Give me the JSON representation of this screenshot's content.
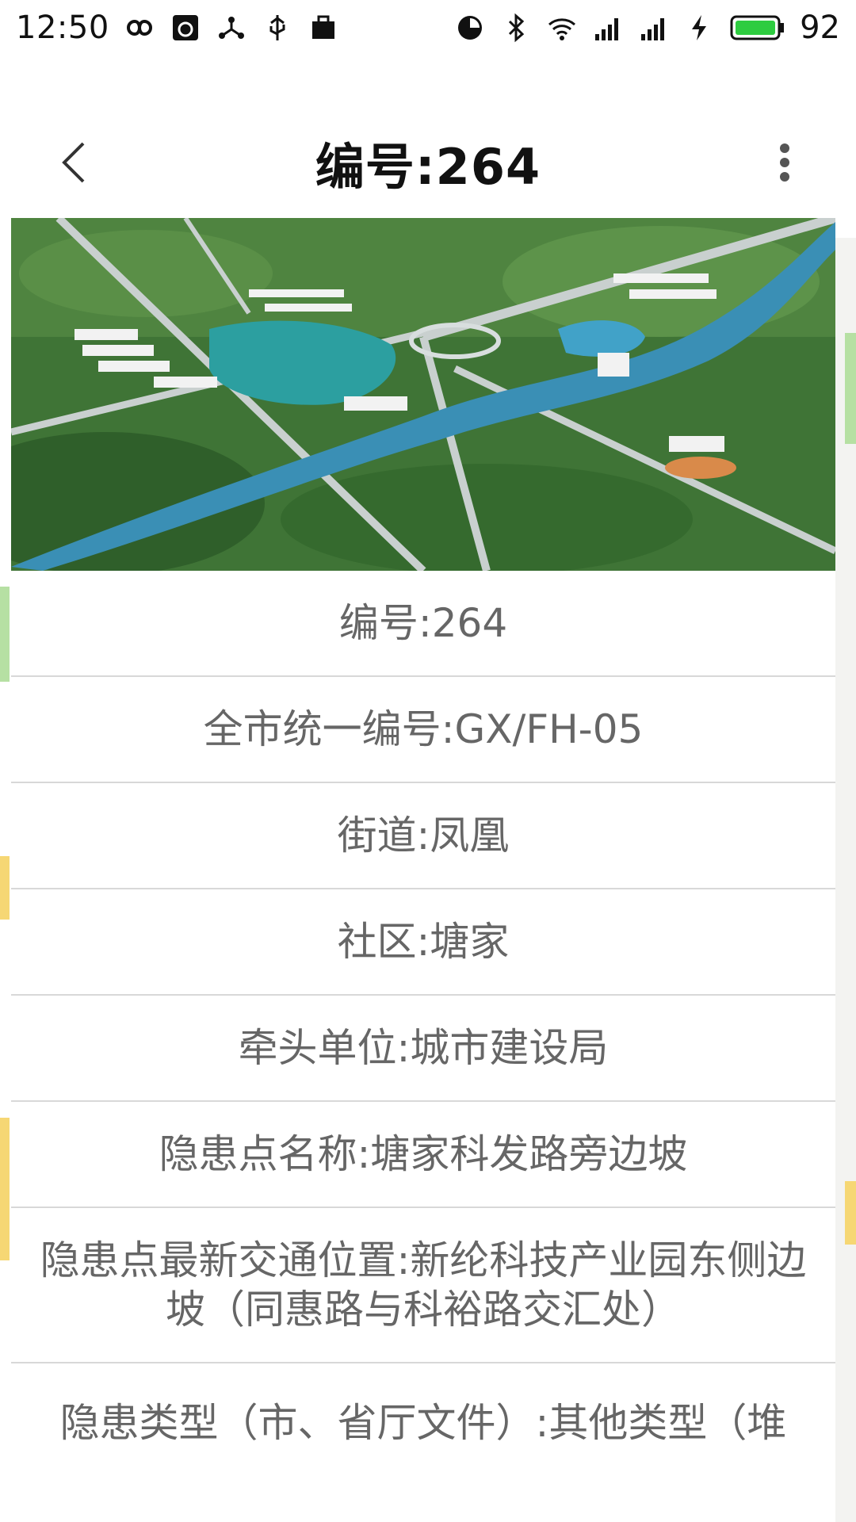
{
  "status_bar": {
    "time": "12:50",
    "battery": "92",
    "icons": [
      "infinity-icon",
      "app-notification-icon",
      "share-icon",
      "usb-icon",
      "briefcase-icon",
      "data-saver-icon",
      "bluetooth-icon",
      "wifi-icon",
      "signal-3g-icon",
      "signal-icon",
      "charging-icon",
      "battery-icon"
    ],
    "battery_color": "#2ecc40"
  },
  "header": {
    "title": "编号:264"
  },
  "details": {
    "rows": [
      "编号:264",
      "全市统一编号:GX/FH-05",
      "街道:凤凰",
      "社区:塘家",
      "牵头单位:城市建设局",
      "隐患点名称:塘家科发路旁边坡",
      "隐患点最新交通位置:新纶科技产业园东侧边坡（同惠路与科裕路交汇处）",
      "隐患类型（市、省厅文件）:其他类型（堆"
    ]
  },
  "colors": {
    "text_secondary": "#666666",
    "divider": "#d8d8d8"
  }
}
